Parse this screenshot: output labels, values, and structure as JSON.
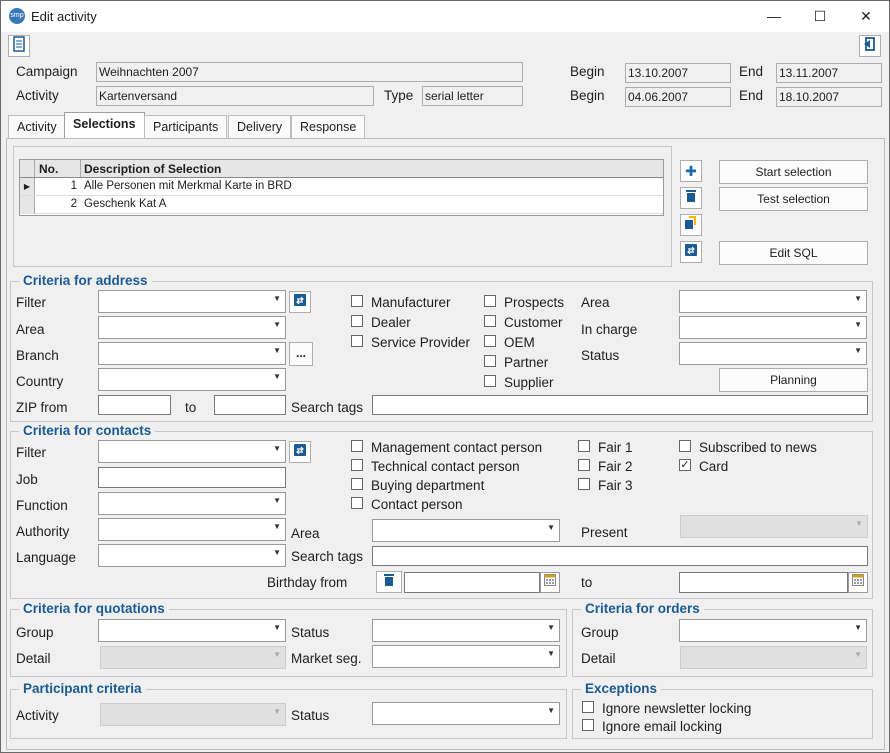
{
  "window": {
    "title": "Edit activity",
    "icon": "smp"
  },
  "header": {
    "campaign_label": "Campaign",
    "campaign_value": "Weihnachten 2007",
    "activity_label": "Activity",
    "activity_value": "Kartenversand",
    "type_label": "Type",
    "type_value": "serial letter",
    "begin_label": "Begin",
    "end_label": "End",
    "campaign_begin": "13.10.2007",
    "campaign_end": "13.11.2007",
    "activity_begin": "04.06.2007",
    "activity_end": "18.10.2007"
  },
  "tabs": [
    "Activity",
    "Selections",
    "Participants",
    "Delivery",
    "Response"
  ],
  "selections": {
    "columns": [
      "No.",
      "Description of Selection"
    ],
    "rows": [
      {
        "no": "1",
        "desc": "Alle Personen mit Merkmal Karte in BRD"
      },
      {
        "no": "2",
        "desc": "Geschenk Kat A"
      }
    ],
    "start_selection": "Start selection",
    "test_selection": "Test selection",
    "edit_sql": "Edit SQL"
  },
  "address": {
    "title": "Criteria for address",
    "filter": "Filter",
    "area": "Area",
    "branch": "Branch",
    "country": "Country",
    "zip_from": "ZIP from",
    "to": "to",
    "search_tags": "Search tags",
    "checks1": [
      {
        "label": "Manufacturer",
        "checked": false
      },
      {
        "label": "Dealer",
        "checked": false
      },
      {
        "label": "Service Provider",
        "checked": false
      }
    ],
    "checks2": [
      {
        "label": "Prospects",
        "checked": false
      },
      {
        "label": "Customer",
        "checked": false
      },
      {
        "label": "OEM",
        "checked": false
      },
      {
        "label": "Partner",
        "checked": false
      },
      {
        "label": "Supplier",
        "checked": false
      }
    ],
    "area2": "Area",
    "in_charge": "In charge",
    "status": "Status",
    "planning": "Planning",
    "more": "..."
  },
  "contacts": {
    "title": "Criteria for contacts",
    "filter": "Filter",
    "job": "Job",
    "function": "Function",
    "authority": "Authority",
    "language": "Language",
    "area": "Area",
    "search_tags": "Search tags",
    "birthday_from": "Birthday from",
    "to": "to",
    "present": "Present",
    "checks1": [
      {
        "label": "Management contact person",
        "checked": false
      },
      {
        "label": "Technical contact person",
        "checked": false
      },
      {
        "label": "Buying department",
        "checked": false
      },
      {
        "label": "Contact person",
        "checked": false
      }
    ],
    "checks2": [
      {
        "label": "Fair 1",
        "checked": false
      },
      {
        "label": "Fair 2",
        "checked": false
      },
      {
        "label": "Fair 3",
        "checked": false
      }
    ],
    "checks3": [
      {
        "label": "Subscribed to news",
        "checked": false
      },
      {
        "label": "Card",
        "checked": true
      }
    ]
  },
  "quotations": {
    "title": "Criteria for quotations",
    "group": "Group",
    "detail": "Detail",
    "status": "Status",
    "market_seg": "Market seg."
  },
  "orders": {
    "title": "Criteria for orders",
    "group": "Group",
    "detail": "Detail"
  },
  "participant": {
    "title": "Participant criteria",
    "activity": "Activity",
    "status": "Status"
  },
  "exceptions": {
    "title": "Exceptions",
    "items": [
      {
        "label": "Ignore newsletter locking",
        "checked": false
      },
      {
        "label": "Ignore email locking",
        "checked": false
      }
    ]
  },
  "colors": {
    "accent": "#1a5b95",
    "icon_blue": "#1a6bb0"
  }
}
